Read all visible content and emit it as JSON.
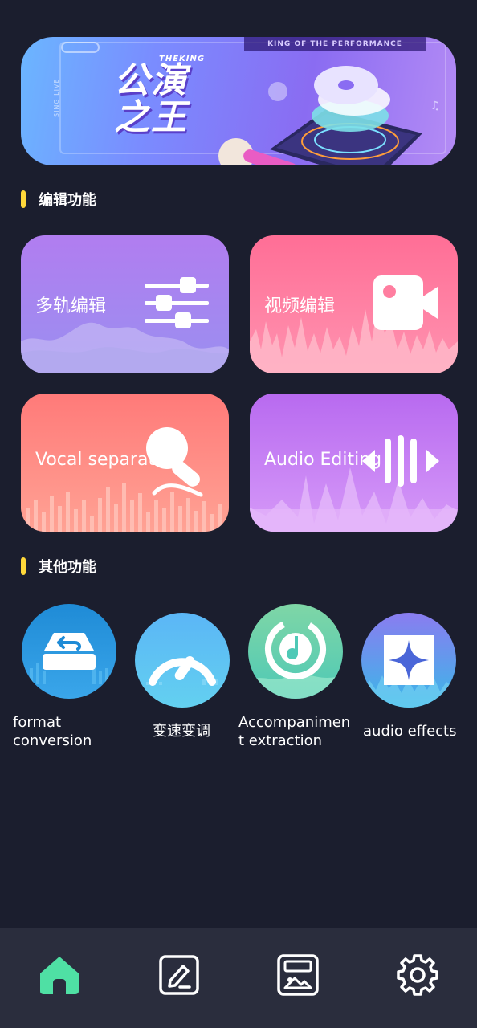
{
  "banner": {
    "tagline": "KING OF THE PERFORMANCE",
    "side_text": "SING LIVE",
    "brand": "THEKING",
    "title": "公演之王"
  },
  "sections": {
    "editing": "编辑功能",
    "other": "其他功能"
  },
  "cards": [
    {
      "label": "多轨编辑",
      "icon": "sliders-icon"
    },
    {
      "label": "视频编辑",
      "icon": "video-camera-icon"
    },
    {
      "label": "Vocal separation",
      "icon": "microphone-icon"
    },
    {
      "label": "Audio Editing",
      "icon": "audio-wave-icon"
    }
  ],
  "tools": [
    {
      "label": "format conversion",
      "icon": "drive-undo-icon"
    },
    {
      "label": "变速变调",
      "icon": "speedometer-icon"
    },
    {
      "label": "Accompaniment extraction",
      "icon": "music-note-circle-icon"
    },
    {
      "label": "audio effects",
      "icon": "sparkle-icon"
    }
  ],
  "nav": [
    {
      "name": "home",
      "icon": "home-icon",
      "active": true
    },
    {
      "name": "edit",
      "icon": "edit-icon",
      "active": false
    },
    {
      "name": "works",
      "icon": "gallery-icon",
      "active": false
    },
    {
      "name": "settings",
      "icon": "gear-icon",
      "active": false
    }
  ],
  "colors": {
    "background": "#1b1e2e",
    "accent_yellow": "#ffd83a",
    "nav_active": "#4fe0a4",
    "nav_bar": "#2a2d3d"
  }
}
